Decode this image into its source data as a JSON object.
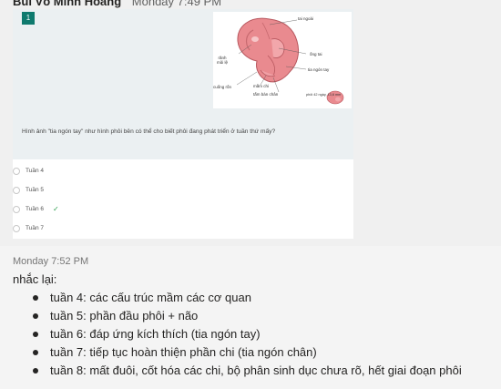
{
  "message1": {
    "sender": "Bùi Võ Minh Hoàng",
    "time": "Monday 7:49 PM",
    "card": {
      "question_number": "1",
      "question": "Hình ảnh \"tia ngón tay\" như hình phôi bên có thể cho biết phôi đang phát triển ở tuần thứ mấy?",
      "figure_labels": {
        "tai_ngoai": "tai ngoài",
        "ong_tai": "ống tai",
        "ranh_mui_le": "rãnh\nmũi lệ",
        "tia_ngon_tay": "tia ngón tay",
        "cuong_ron": "cuống rốn",
        "mam_chi": "mầm chi",
        "tam_ban_chan": "tấm bàn chân",
        "age": "phôi 42 ngày, 13,6 mm"
      },
      "options": [
        {
          "label": "Tuần 4",
          "correct": false
        },
        {
          "label": "Tuần 5",
          "correct": false
        },
        {
          "label": "Tuần 6",
          "correct": true
        },
        {
          "label": "Tuần 7",
          "correct": false
        }
      ],
      "check_icon": "check-icon",
      "accent_color": "#0e7a6e",
      "check_color": "#2e9e4f"
    }
  },
  "message2": {
    "time": "Monday 7:52 PM",
    "intro": "nhắc lại:",
    "items": [
      "tuần 4: các cấu trúc mầm các cơ quan",
      "tuần 5: phần đầu phôi + não",
      "tuần 6: đáp ứng kích thích (tia ngón tay)",
      "tuần 7: tiếp tục hoàn thiện phần chi (tia ngón chân)",
      "tuần 8: mất đuôi, cốt hóa các chi, bộ phân sinh dục chưa rõ, hết giai đoạn phôi"
    ]
  }
}
